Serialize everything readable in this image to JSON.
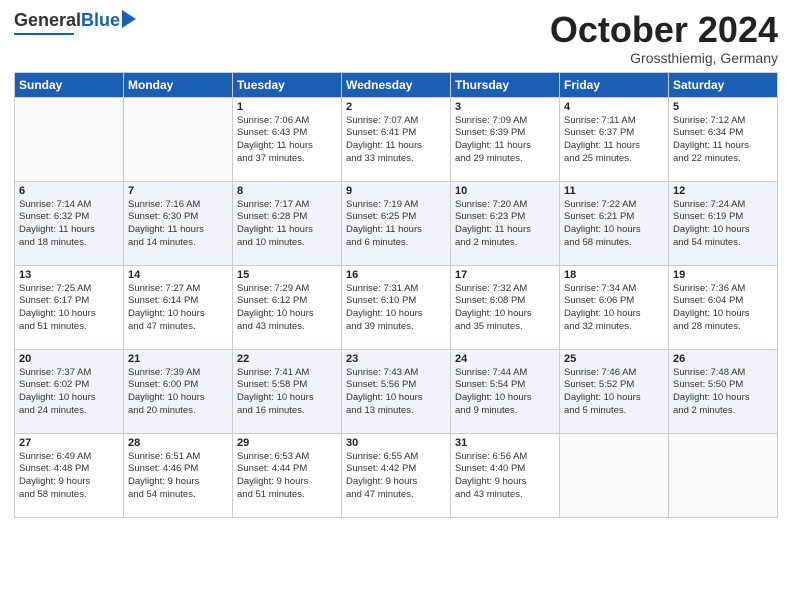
{
  "header": {
    "logo_general": "General",
    "logo_blue": "Blue",
    "month_title": "October 2024",
    "location": "Grossthiemig, Germany"
  },
  "days_of_week": [
    "Sunday",
    "Monday",
    "Tuesday",
    "Wednesday",
    "Thursday",
    "Friday",
    "Saturday"
  ],
  "weeks": [
    [
      {
        "day": "",
        "content": ""
      },
      {
        "day": "",
        "content": ""
      },
      {
        "day": "1",
        "content": "Sunrise: 7:06 AM\nSunset: 6:43 PM\nDaylight: 11 hours\nand 37 minutes."
      },
      {
        "day": "2",
        "content": "Sunrise: 7:07 AM\nSunset: 6:41 PM\nDaylight: 11 hours\nand 33 minutes."
      },
      {
        "day": "3",
        "content": "Sunrise: 7:09 AM\nSunset: 6:39 PM\nDaylight: 11 hours\nand 29 minutes."
      },
      {
        "day": "4",
        "content": "Sunrise: 7:11 AM\nSunset: 6:37 PM\nDaylight: 11 hours\nand 25 minutes."
      },
      {
        "day": "5",
        "content": "Sunrise: 7:12 AM\nSunset: 6:34 PM\nDaylight: 11 hours\nand 22 minutes."
      }
    ],
    [
      {
        "day": "6",
        "content": "Sunrise: 7:14 AM\nSunset: 6:32 PM\nDaylight: 11 hours\nand 18 minutes."
      },
      {
        "day": "7",
        "content": "Sunrise: 7:16 AM\nSunset: 6:30 PM\nDaylight: 11 hours\nand 14 minutes."
      },
      {
        "day": "8",
        "content": "Sunrise: 7:17 AM\nSunset: 6:28 PM\nDaylight: 11 hours\nand 10 minutes."
      },
      {
        "day": "9",
        "content": "Sunrise: 7:19 AM\nSunset: 6:25 PM\nDaylight: 11 hours\nand 6 minutes."
      },
      {
        "day": "10",
        "content": "Sunrise: 7:20 AM\nSunset: 6:23 PM\nDaylight: 11 hours\nand 2 minutes."
      },
      {
        "day": "11",
        "content": "Sunrise: 7:22 AM\nSunset: 6:21 PM\nDaylight: 10 hours\nand 58 minutes."
      },
      {
        "day": "12",
        "content": "Sunrise: 7:24 AM\nSunset: 6:19 PM\nDaylight: 10 hours\nand 54 minutes."
      }
    ],
    [
      {
        "day": "13",
        "content": "Sunrise: 7:25 AM\nSunset: 6:17 PM\nDaylight: 10 hours\nand 51 minutes."
      },
      {
        "day": "14",
        "content": "Sunrise: 7:27 AM\nSunset: 6:14 PM\nDaylight: 10 hours\nand 47 minutes."
      },
      {
        "day": "15",
        "content": "Sunrise: 7:29 AM\nSunset: 6:12 PM\nDaylight: 10 hours\nand 43 minutes."
      },
      {
        "day": "16",
        "content": "Sunrise: 7:31 AM\nSunset: 6:10 PM\nDaylight: 10 hours\nand 39 minutes."
      },
      {
        "day": "17",
        "content": "Sunrise: 7:32 AM\nSunset: 6:08 PM\nDaylight: 10 hours\nand 35 minutes."
      },
      {
        "day": "18",
        "content": "Sunrise: 7:34 AM\nSunset: 6:06 PM\nDaylight: 10 hours\nand 32 minutes."
      },
      {
        "day": "19",
        "content": "Sunrise: 7:36 AM\nSunset: 6:04 PM\nDaylight: 10 hours\nand 28 minutes."
      }
    ],
    [
      {
        "day": "20",
        "content": "Sunrise: 7:37 AM\nSunset: 6:02 PM\nDaylight: 10 hours\nand 24 minutes."
      },
      {
        "day": "21",
        "content": "Sunrise: 7:39 AM\nSunset: 6:00 PM\nDaylight: 10 hours\nand 20 minutes."
      },
      {
        "day": "22",
        "content": "Sunrise: 7:41 AM\nSunset: 5:58 PM\nDaylight: 10 hours\nand 16 minutes."
      },
      {
        "day": "23",
        "content": "Sunrise: 7:43 AM\nSunset: 5:56 PM\nDaylight: 10 hours\nand 13 minutes."
      },
      {
        "day": "24",
        "content": "Sunrise: 7:44 AM\nSunset: 5:54 PM\nDaylight: 10 hours\nand 9 minutes."
      },
      {
        "day": "25",
        "content": "Sunrise: 7:46 AM\nSunset: 5:52 PM\nDaylight: 10 hours\nand 5 minutes."
      },
      {
        "day": "26",
        "content": "Sunrise: 7:48 AM\nSunset: 5:50 PM\nDaylight: 10 hours\nand 2 minutes."
      }
    ],
    [
      {
        "day": "27",
        "content": "Sunrise: 6:49 AM\nSunset: 4:48 PM\nDaylight: 9 hours\nand 58 minutes."
      },
      {
        "day": "28",
        "content": "Sunrise: 6:51 AM\nSunset: 4:46 PM\nDaylight: 9 hours\nand 54 minutes."
      },
      {
        "day": "29",
        "content": "Sunrise: 6:53 AM\nSunset: 4:44 PM\nDaylight: 9 hours\nand 51 minutes."
      },
      {
        "day": "30",
        "content": "Sunrise: 6:55 AM\nSunset: 4:42 PM\nDaylight: 9 hours\nand 47 minutes."
      },
      {
        "day": "31",
        "content": "Sunrise: 6:56 AM\nSunset: 4:40 PM\nDaylight: 9 hours\nand 43 minutes."
      },
      {
        "day": "",
        "content": ""
      },
      {
        "day": "",
        "content": ""
      }
    ]
  ]
}
